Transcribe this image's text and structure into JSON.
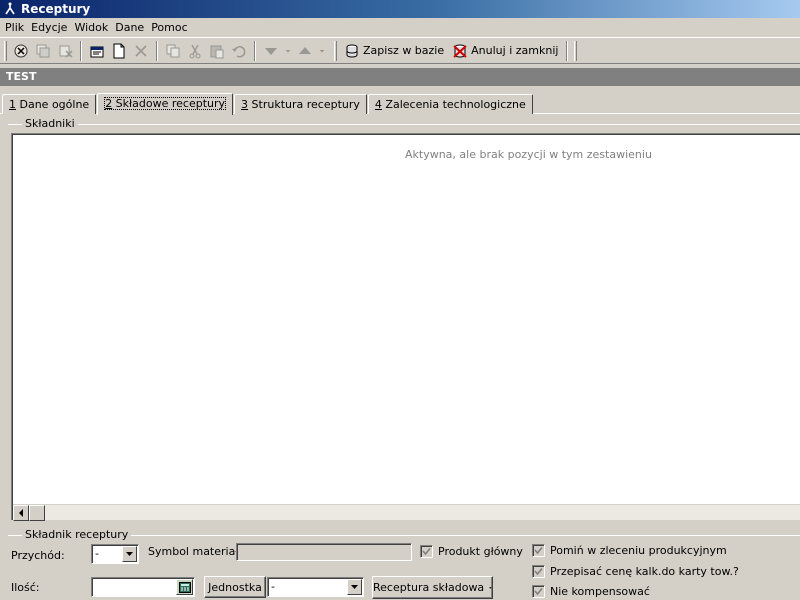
{
  "window": {
    "title": "Receptury"
  },
  "menu": [
    "Plik",
    "Edycje",
    "Widok",
    "Dane",
    "Pomoc"
  ],
  "toolbar": {
    "save_label": "Zapisz w bazie",
    "cancel_label": "Anuluj i zamknij"
  },
  "record": {
    "name": "TEST"
  },
  "tabs": [
    {
      "key": "1",
      "label": " Dane ogólne",
      "active": false
    },
    {
      "key": "2",
      "label": " Składowe receptury",
      "active": true
    },
    {
      "key": "3",
      "label": " Struktura receptury",
      "active": false
    },
    {
      "key": "4",
      "label": " Zalecenia technologiczne",
      "active": false
    }
  ],
  "components_group": {
    "label": "Składniki",
    "empty_message": "Aktywna, ale brak pozycji w tym zestawieniu"
  },
  "component_form": {
    "group_label": "Składnik receptury",
    "income_label": "Przychód:",
    "income_value": "-",
    "material_symbol_label": "Symbol materiału:",
    "material_symbol_value": "",
    "main_product_label": "Produkt główny",
    "main_product_checked": true,
    "quantity_label": "Ilość:",
    "quantity_value": "",
    "unit_button": "Jednostka",
    "unit_value": "-",
    "component_recipe_button": "Receptura składowa",
    "skip_in_order_label": "Pomiń w zleceniu produkcyjnym",
    "skip_in_order_checked": true,
    "copy_price_label": "Przepisać cenę kalk.do karty tow.?",
    "copy_price_checked": true,
    "no_compensate_label": "Nie kompensować",
    "no_compensate_checked": true
  }
}
